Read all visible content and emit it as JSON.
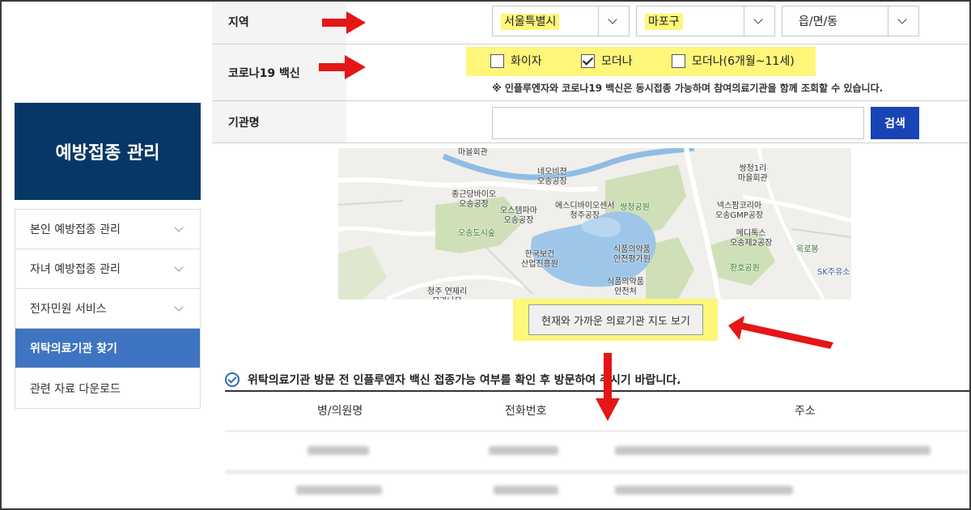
{
  "sidebar": {
    "title": "예방접종 관리",
    "items": [
      {
        "label": "본인 예방접종 관리"
      },
      {
        "label": "자녀 예방접종 관리"
      },
      {
        "label": "전자민원 서비스"
      },
      {
        "label": "위탁의료기관 찾기"
      },
      {
        "label": "관련 자료 다운로드"
      }
    ]
  },
  "form": {
    "region_label": "지역",
    "city_value": "서울특별시",
    "district_value": "마포구",
    "dong_value": "읍/면/동",
    "vaccine_label": "코로나19 백신",
    "vaccines": [
      {
        "label": "화이자",
        "checked": false
      },
      {
        "label": "모더나",
        "checked": true
      },
      {
        "label": "모더나(6개월~11세)",
        "checked": false
      }
    ],
    "note": "※ 인플루엔자와 코로나19 백신은 동시접종 가능하며 참여의료기관을 함께 조회할 수 있습니다.",
    "name_label": "기관명",
    "name_value": "",
    "search_label": "검색"
  },
  "map": {
    "labels": {
      "maeul": "마을회관",
      "neo": "네오비젼\n오송공장",
      "jonggeun": "종근당바이오\n오송공장",
      "osstem": "오스템파마\n오송공장",
      "esd": "에스디바이오센서\n청주공장",
      "ssangcheong_park": "쌍청공원",
      "ssangcheong_hall": "쌍청1리\n마을회관",
      "nexpharm": "넥스팜코리아\n오송GMP공장",
      "medytox": "메디톡스\n오송제2공장",
      "oksan": "옥로봉",
      "forest": "오송도시숲",
      "kohi": "한국보건\n산업진흥원",
      "mfds_eval": "식품의약품\n안전평가원",
      "mfds": "식품의약품\n안전처",
      "hwanho": "환호공원",
      "sk": "SK주유소",
      "cheongju": "청주 연제리\n모과나무"
    },
    "button_label": "현재와 가까운 의료기관 지도 보기"
  },
  "notice": "위탁의료기관 방문 전 인플루엔자 백신 접종가능 여부를 확인 후 방문하여 주시기 바랍니다.",
  "table": {
    "headers": [
      "병/의원명",
      "전화번호",
      "주소"
    ]
  },
  "colors": {
    "sidebar_header": "#073766",
    "sidebar_active": "#3f74c2",
    "search_button": "#1944b5",
    "highlight": "#fff67a",
    "annotation_arrow": "#e41616"
  }
}
